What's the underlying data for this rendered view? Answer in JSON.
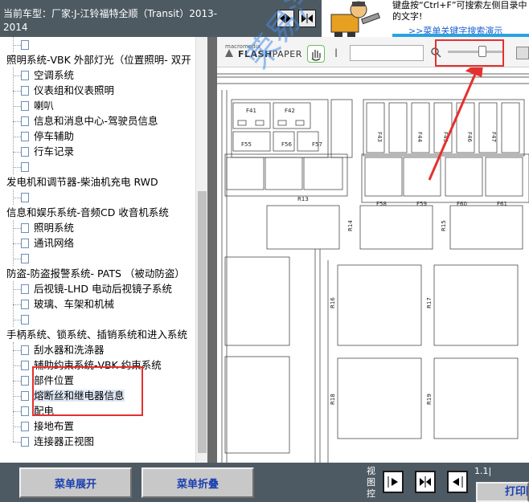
{
  "header": {
    "car_line1": "当前车型：厂家:J-江铃福特全顺（Transit）2013-",
    "car_line2": "2014"
  },
  "hint": {
    "text": "键盘按“Ctrl+F”可搜索左侧目录中的文字!",
    "link": ">>菜单关键字搜索演示"
  },
  "menu": {
    "rows": [
      {
        "kind": "child",
        "label": ""
      },
      {
        "kind": "group",
        "label": "照明系统-VBK 外部灯光（位置照明- 双开"
      },
      {
        "kind": "child",
        "label": "空调系统"
      },
      {
        "kind": "child",
        "label": "仪表组和仪表照明"
      },
      {
        "kind": "child",
        "label": "喇叭"
      },
      {
        "kind": "child",
        "label": "信息和消息中心-驾驶员信息"
      },
      {
        "kind": "child",
        "label": "停车辅助"
      },
      {
        "kind": "child",
        "label": "行车记录"
      },
      {
        "kind": "child",
        "label": ""
      },
      {
        "kind": "group",
        "label": "发电机和调节器-柴油机充电 RWD"
      },
      {
        "kind": "child",
        "label": ""
      },
      {
        "kind": "group",
        "label": "信息和娱乐系统-音频CD 收音机系统"
      },
      {
        "kind": "child",
        "label": "照明系统"
      },
      {
        "kind": "child",
        "label": "通讯网络"
      },
      {
        "kind": "child",
        "label": ""
      },
      {
        "kind": "group",
        "label": "防盗-防盗报警系统- PATS （被动防盗）"
      },
      {
        "kind": "child",
        "label": "后视镜-LHD 电动后视镜子系统"
      },
      {
        "kind": "child",
        "label": "玻璃、车架和机械"
      },
      {
        "kind": "child",
        "label": ""
      },
      {
        "kind": "group",
        "label": "手柄系统、锁系统、插销系统和进入系统"
      },
      {
        "kind": "child",
        "label": "刮水器和洗涤器"
      },
      {
        "kind": "child",
        "label": "辅助约束系统-VBK 约束系统"
      },
      {
        "kind": "child",
        "label": "部件位置"
      },
      {
        "kind": "child",
        "label": "熔断丝和继电器信息",
        "selected": true
      },
      {
        "kind": "child",
        "label": "配电"
      },
      {
        "kind": "child",
        "label": "接地布置"
      },
      {
        "kind": "child",
        "label": "连接器正视图"
      }
    ]
  },
  "flash": {
    "logo_small": "macromedia",
    "logo_big_a": "FLASH",
    "logo_big_b": "PAPER"
  },
  "diagram": {
    "labels": [
      "F41",
      "F42",
      "F43",
      "F44",
      "F45",
      "F46",
      "F47",
      "F55",
      "F56",
      "F57",
      "R13",
      "F58",
      "F59",
      "F60",
      "F61",
      "R14",
      "R15",
      "R16",
      "R17",
      "R18",
      "R19"
    ]
  },
  "watermark": "荣易汽车维修平台",
  "bottom": {
    "expand_label": "菜单展开",
    "collapse_label": "菜单折叠",
    "view_label": "视图控",
    "zoom_text": "1.1|",
    "print_label": "打印图"
  },
  "colors": {
    "accent_red": "#e53030",
    "button_text": "#1a3fb0",
    "link": "#1a5fd0"
  }
}
